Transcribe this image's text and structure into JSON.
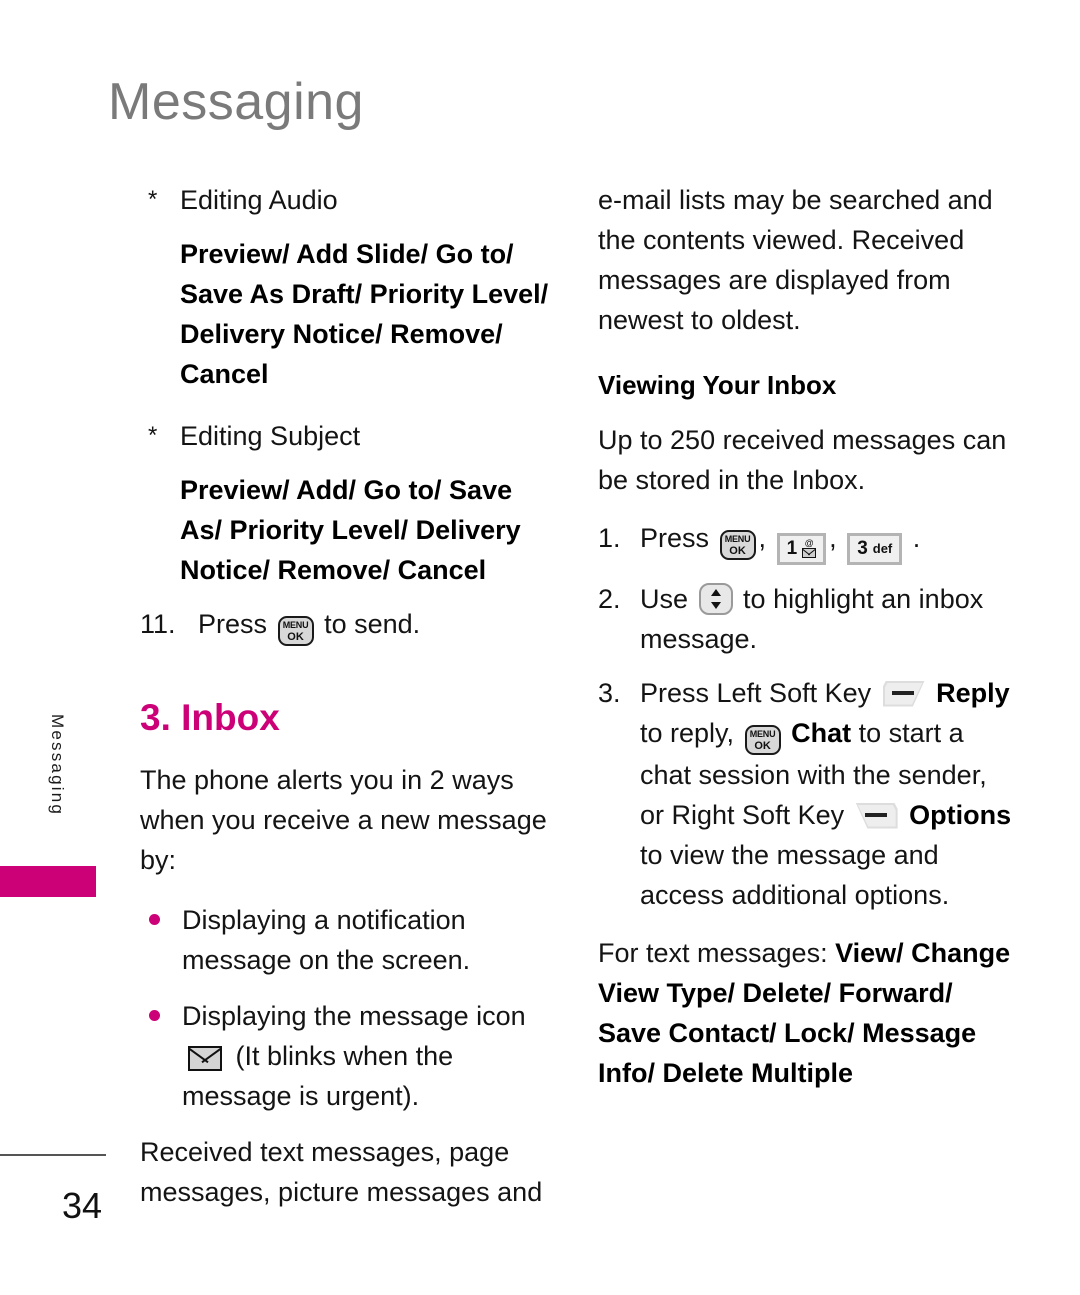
{
  "header": {
    "title": "Messaging"
  },
  "side_tab": {
    "label": "Messaging",
    "accent_color": "#cc0077"
  },
  "footer": {
    "page_number": "34"
  },
  "colors": {
    "accent": "#cc0077",
    "title_gray": "#7a7a7a",
    "body": "#141414"
  },
  "left_column": {
    "star_item_1": {
      "mark": "*",
      "text": "Editing Audio"
    },
    "options_1": "Preview/ Add Slide/ Go to/ Save As Draft/ Priority Level/ Delivery Notice/ Remove/ Cancel",
    "star_item_2": {
      "mark": "*",
      "text": "Editing Subject"
    },
    "options_2": "Preview/ Add/ Go to/ Save As/ Priority Level/ Delivery Notice/ Remove/ Cancel",
    "step_11": {
      "number": "11.",
      "before": "Press",
      "key": "menu-ok-key",
      "after": "to send."
    },
    "section_heading": "3. Inbox",
    "intro_paragraph": "The phone alerts you in 2 ways when you receive a new message by:",
    "bullets": [
      {
        "text": "Displaying a notification message on the screen."
      },
      {
        "text_before": "Displaying the message icon",
        "icon": "message-envelope-icon",
        "text_after": "(It blinks when the message is urgent)."
      }
    ],
    "closing_paragraph": "Received text messages, page messages, picture messages and"
  },
  "right_column": {
    "continued_paragraph": "e-mail lists may be searched and the contents viewed. Received messages are displayed from newest to oldest.",
    "sub_heading": "Viewing Your Inbox",
    "capacity_paragraph": "Up to 250 received messages can be stored in the Inbox.",
    "step_1": {
      "number": "1.",
      "before": "Press",
      "keys": [
        {
          "name": "menu-ok-key",
          "top": "MENU",
          "bottom": "OK"
        },
        {
          "name": "key-1",
          "digit": "1",
          "sub": "@"
        },
        {
          "name": "key-3-def",
          "digit": "3",
          "sub": "def"
        }
      ],
      "separator": ",",
      "after": "."
    },
    "step_2": {
      "number": "2.",
      "before": "Use",
      "key": "navigation-up-down-key",
      "after": "to highlight an inbox message."
    },
    "step_3": {
      "number": "3.",
      "part1": "Press Left Soft Key",
      "left_soft_key": "left-soft-key",
      "reply_label": "Reply",
      "part2": "to reply,",
      "menu_key": "menu-ok-key",
      "chat_label": "Chat",
      "part3": "to start a chat session with the sender, or Right Soft Key",
      "right_soft_key": "right-soft-key",
      "options_label": "Options",
      "part4": "to view the message and access additional options."
    },
    "text_messages_label": "For text messages:",
    "text_messages_options": "View/ Change View Type/ Delete/ Forward/ Save Contact/ Lock/ Message Info/ Delete Multiple"
  },
  "key_glyphs": {
    "menu_ok_top": "MENU",
    "menu_ok_bottom": "OK",
    "key1_digit": "1",
    "key1_at": "@",
    "key3_digit": "3",
    "key3_sub": "def"
  }
}
